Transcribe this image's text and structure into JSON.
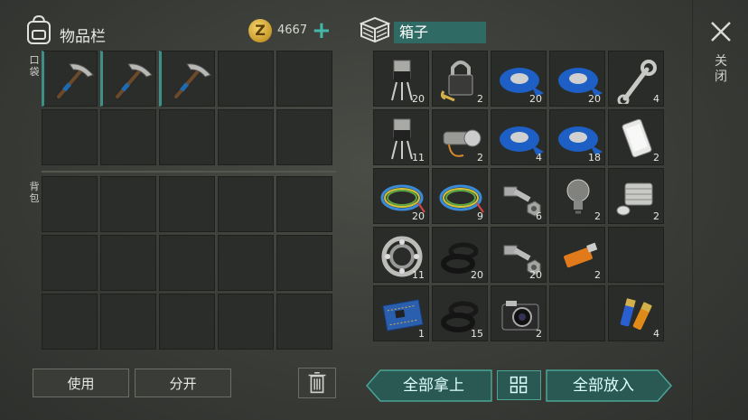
{
  "inventory": {
    "title": "物品栏",
    "coins": "4667",
    "coin_symbol": "Z",
    "add_label": "+",
    "pocket_label": "口袋",
    "backpack_label": "背包",
    "use_button": "使用",
    "split_button": "分开"
  },
  "box": {
    "title": "箱子",
    "close_label": "关闭",
    "take_all": "全部拿上",
    "put_all": "全部放入"
  },
  "pocket_items": [
    {
      "icon": "pickaxe-icon",
      "count": ""
    },
    {
      "icon": "pickaxe-icon",
      "count": ""
    },
    {
      "icon": "pickaxe-icon",
      "count": ""
    }
  ],
  "box_items": [
    {
      "icon": "transistor-icon",
      "count": "20"
    },
    {
      "icon": "padlock-icon",
      "count": "2"
    },
    {
      "icon": "tape-icon",
      "count": "20"
    },
    {
      "icon": "tape-icon",
      "count": "20"
    },
    {
      "icon": "wrench-icon",
      "count": "4"
    },
    {
      "icon": "transistor-icon",
      "count": "11"
    },
    {
      "icon": "flashlight-icon",
      "count": "2"
    },
    {
      "icon": "tape-icon",
      "count": "4"
    },
    {
      "icon": "tape-icon",
      "count": "18"
    },
    {
      "icon": "smartphone-icon",
      "count": "2"
    },
    {
      "icon": "wires-icon",
      "count": "20"
    },
    {
      "icon": "wires-icon",
      "count": "9"
    },
    {
      "icon": "bolt-nut-icon",
      "count": "6"
    },
    {
      "icon": "light-bulb-icon",
      "count": "2"
    },
    {
      "icon": "engine-part-icon",
      "count": "2"
    },
    {
      "icon": "bearing-icon",
      "count": "11"
    },
    {
      "icon": "rubber-rings-icon",
      "count": "20"
    },
    {
      "icon": "bolt-nut-icon",
      "count": "20"
    },
    {
      "icon": "usb-drive-icon",
      "count": "2"
    },
    {
      "icon": "",
      "count": ""
    },
    {
      "icon": "circuit-board-icon",
      "count": "1"
    },
    {
      "icon": "rubber-rings-icon",
      "count": "15"
    },
    {
      "icon": "camera-icon",
      "count": "2"
    },
    {
      "icon": "",
      "count": ""
    },
    {
      "icon": "batteries-icon",
      "count": "4"
    }
  ],
  "colors": {
    "accent": "#3fb3a3",
    "header_box": "#2f6b64",
    "coin": "#e0b43a"
  }
}
